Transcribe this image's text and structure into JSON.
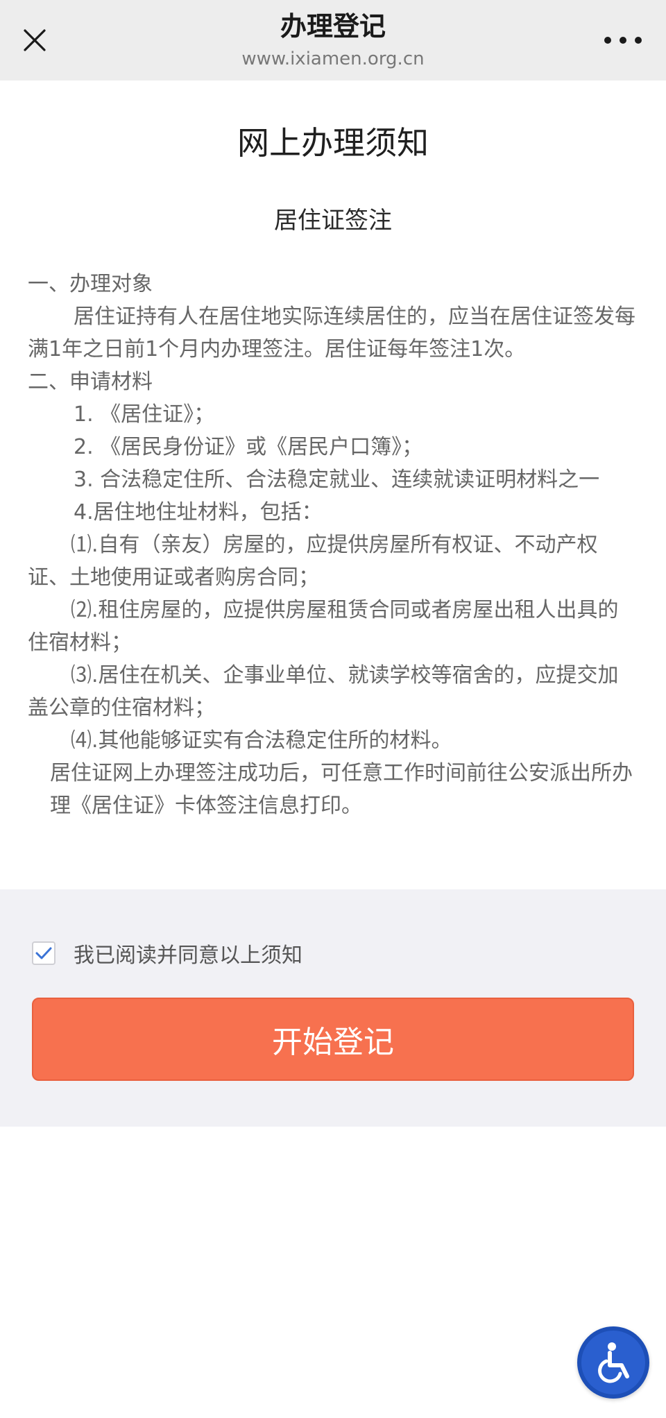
{
  "nav": {
    "title": "办理登记",
    "url": "www.ixiamen.org.cn",
    "close_icon": "close-icon",
    "more_icon": "more-horizontal-icon"
  },
  "notice": {
    "heading": "网上办理须知",
    "subheading": "居住证签注",
    "section1_title": "一、办理对象",
    "section1_body": "居住证持有人在居住地实际连续居住的，应当在居住证签发每满1年之日前1个月内办理签注。居住证每年签注1次。",
    "section2_title": "二、申请材料",
    "items": [
      "1. 《居住证》；",
      "2. 《居民身份证》或《居民户口簿》；",
      "3. 合法稳定住所、合法稳定就业、连续就读证明材料之一",
      "4.居住地住址材料，包括："
    ],
    "subitems": [
      "⑴.自有（亲友）房屋的，应提供房屋所有权证、不动产权证、土地使用证或者购房合同；",
      "⑵.租住房屋的，应提供房屋租赁合同或者房屋出租人出具的住宿材料；",
      "⑶.居住在机关、企事业单位、就读学校等宿舍的，应提交加盖公章的住宿材料；",
      "⑷.其他能够证实有合法稳定住所的材料。"
    ],
    "closing_note": "居住证网上办理签注成功后，可任意工作时间前往公安派出所办理《居住证》卡体签注信息打印。"
  },
  "agreement": {
    "checked": true,
    "label": "我已阅读并同意以上须知",
    "check_icon": "checkmark-icon"
  },
  "actions": {
    "start_label": "开始登记"
  },
  "accessibility": {
    "icon": "wheelchair-icon"
  },
  "colors": {
    "accent": "#f7714f",
    "nav_bg": "#ededed",
    "panel_bg": "#f1f1f5",
    "checkbox_check": "#3b73d6",
    "a11y_bg": "#2a5fcf"
  }
}
